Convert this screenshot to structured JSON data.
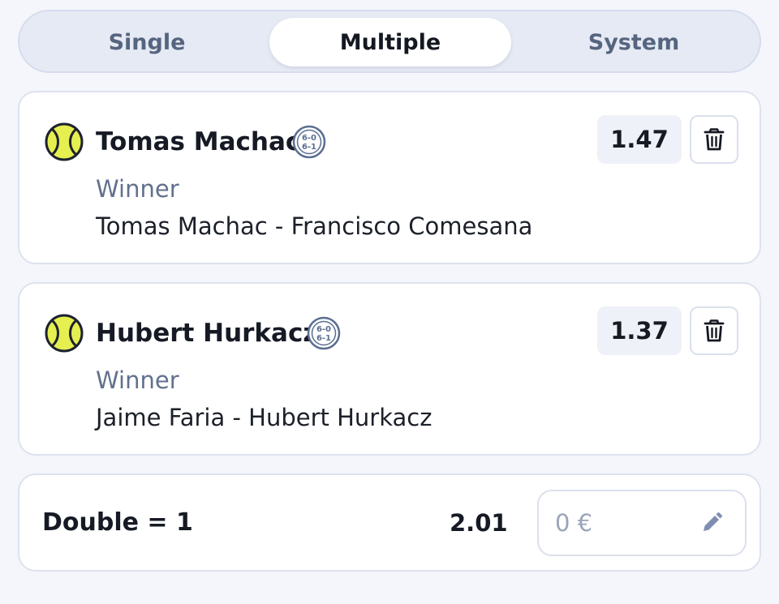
{
  "tabs": [
    {
      "label": "Single",
      "active": false
    },
    {
      "label": "Multiple",
      "active": true
    },
    {
      "label": "System",
      "active": false
    }
  ],
  "bets": [
    {
      "player": "Tomas Machac",
      "market": "Winner",
      "event": "Tomas Machac - Francisco Comesana",
      "odds": "1.47",
      "icons": [
        "tennis-ball-icon",
        "live-score-icon",
        "trash-icon"
      ]
    },
    {
      "player": "Hubert Hurkacz",
      "market": "Winner",
      "event": "Jaime Faria - Hubert Hurkacz",
      "odds": "1.37",
      "icons": [
        "tennis-ball-icon",
        "live-score-icon",
        "trash-icon"
      ]
    }
  ],
  "summary": {
    "combination": "Double = 1",
    "total_odds": "2.01",
    "stake_value": "0 €",
    "stake_icon": "pencil-icon"
  },
  "score_icon_text": {
    "top": "6-0",
    "bottom": "6-1"
  },
  "colors": {
    "ball": "#e5ef4f",
    "active_tab_bg": "#ffffff",
    "tabbar_bg": "#e6eaf4",
    "muted_text": "#62718d",
    "icon_blue": "#5b6e91",
    "pencil": "#7f8eb0"
  }
}
